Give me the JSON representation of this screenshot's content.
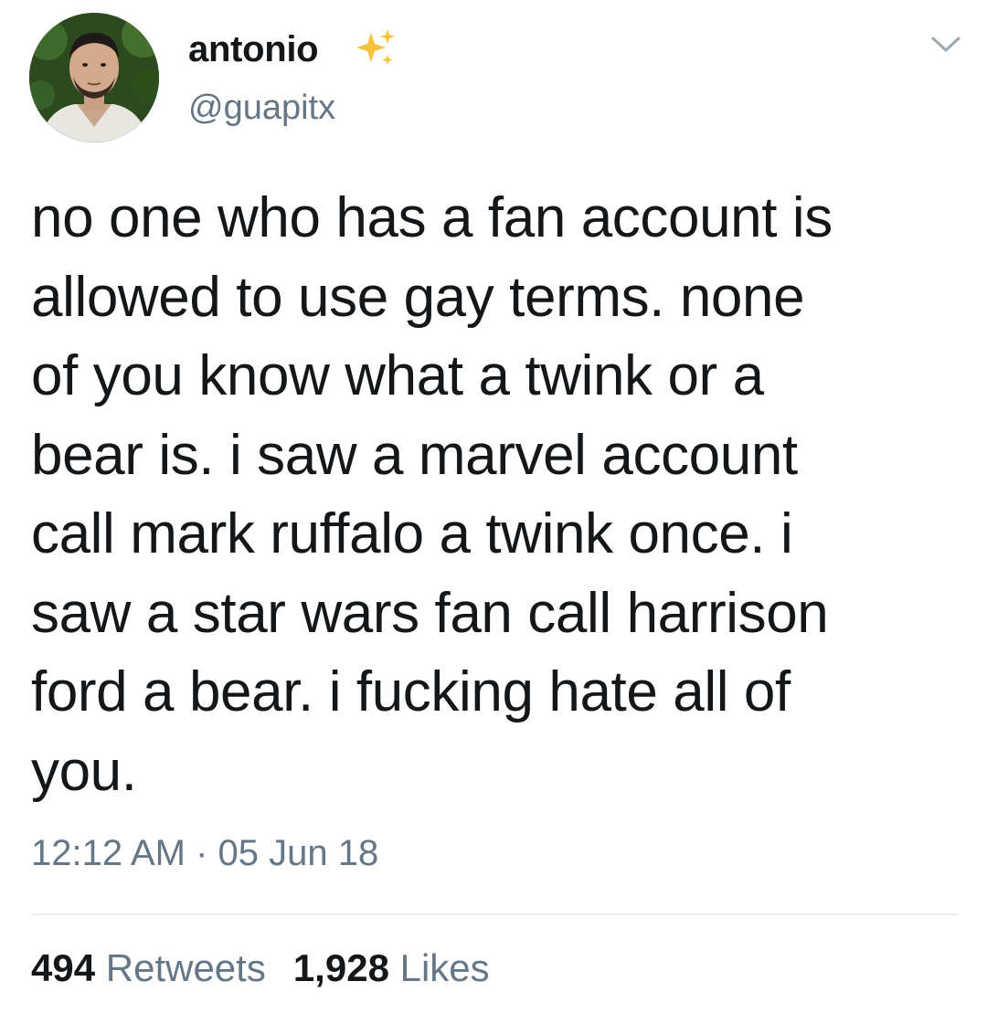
{
  "user": {
    "display_name": "antonio",
    "handle": "@guapitx",
    "badge_icon": "sparkles-icon"
  },
  "tweet": {
    "lines": [
      "no one who has a fan account is",
      "allowed to use gay terms. none",
      "of you know what a twink or a",
      "bear is. i saw a marvel account",
      "call mark ruffalo a twink once. i",
      "saw a star wars fan call harrison",
      "ford a bear. i fucking hate all of",
      "you."
    ],
    "timestamp": "12:12 AM · 05 Jun 18"
  },
  "stats": {
    "retweets_count": "494",
    "retweets_label": "Retweets",
    "likes_count": "1,928",
    "likes_label": "Likes"
  },
  "colors": {
    "text": "#14171a",
    "secondary": "#657786",
    "divider": "#e6ecf0",
    "sparkle": "#f5c33b"
  }
}
